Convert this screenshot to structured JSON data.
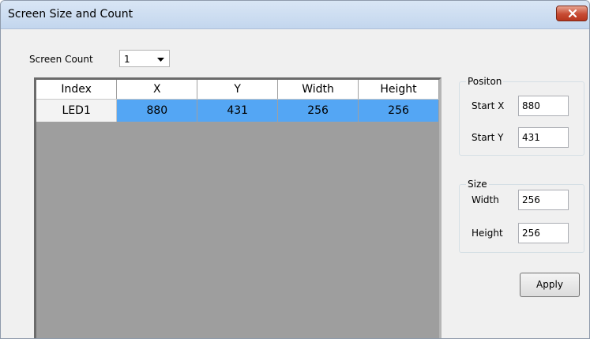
{
  "window": {
    "title": "Screen Size and Count"
  },
  "icons": {
    "close": "close-icon",
    "dropdown": "chevron-down-icon"
  },
  "screen_count": {
    "label": "Screen Count",
    "value": "1"
  },
  "grid": {
    "columns": [
      "Index",
      "X",
      "Y",
      "Width",
      "Height"
    ],
    "rows": [
      {
        "index": "LED1",
        "x": "880",
        "y": "431",
        "width": "256",
        "height": "256",
        "selected": true
      }
    ]
  },
  "position": {
    "legend": "Positon",
    "start_x_label": "Start X",
    "start_x": "880",
    "start_y_label": "Start Y",
    "start_y": "431"
  },
  "size": {
    "legend": "Size",
    "width_label": "Width",
    "width": "256",
    "height_label": "Height",
    "height": "256"
  },
  "apply_label": "Apply",
  "colors": {
    "selected_row": "#54a6f4",
    "grid_background": "#9e9e9e",
    "close_button": "#c74b33"
  }
}
